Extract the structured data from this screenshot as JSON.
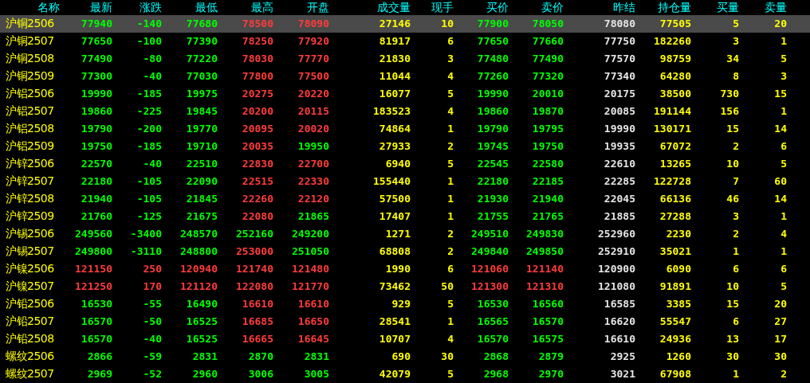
{
  "columns": [
    "名称",
    "最新",
    "涨跌",
    "最低",
    "最高",
    "开盘",
    "成交量",
    "现手",
    "买价",
    "卖价",
    "昨结",
    "持仓量",
    "买量",
    "卖量"
  ],
  "rows": [
    {
      "name": "沪铜2506",
      "selected": true,
      "cells": [
        {
          "text": "77940",
          "color": "#00ff00"
        },
        {
          "text": "-140",
          "color": "#00ff00"
        },
        {
          "text": "77680",
          "color": "#00ff00"
        },
        {
          "text": "78500",
          "color": "#ff3c3c"
        },
        {
          "text": "78090",
          "color": "#ff3c3c"
        },
        {
          "text": "27146",
          "color": "#ffff00"
        },
        {
          "text": "10",
          "color": "#ffff00"
        },
        {
          "text": "77900",
          "color": "#00ff00"
        },
        {
          "text": "78050",
          "color": "#00ff00"
        },
        {
          "text": "78080",
          "color": "#e6e6e6"
        },
        {
          "text": "77505",
          "color": "#ffff00"
        },
        {
          "text": "5",
          "color": "#ffff00"
        },
        {
          "text": "20",
          "color": "#ffff00"
        }
      ]
    },
    {
      "name": "沪铜2507",
      "selected": false,
      "cells": [
        {
          "text": "77650",
          "color": "#00ff00"
        },
        {
          "text": "-100",
          "color": "#00ff00"
        },
        {
          "text": "77390",
          "color": "#00ff00"
        },
        {
          "text": "78250",
          "color": "#ff3c3c"
        },
        {
          "text": "77920",
          "color": "#ff3c3c"
        },
        {
          "text": "81917",
          "color": "#ffff00"
        },
        {
          "text": "6",
          "color": "#ffff00"
        },
        {
          "text": "77650",
          "color": "#00ff00"
        },
        {
          "text": "77660",
          "color": "#00ff00"
        },
        {
          "text": "77750",
          "color": "#e6e6e6"
        },
        {
          "text": "182260",
          "color": "#ffff00"
        },
        {
          "text": "3",
          "color": "#ffff00"
        },
        {
          "text": "1",
          "color": "#ffff00"
        }
      ]
    },
    {
      "name": "沪铜2508",
      "selected": false,
      "cells": [
        {
          "text": "77490",
          "color": "#00ff00"
        },
        {
          "text": "-80",
          "color": "#00ff00"
        },
        {
          "text": "77220",
          "color": "#00ff00"
        },
        {
          "text": "78030",
          "color": "#ff3c3c"
        },
        {
          "text": "77770",
          "color": "#ff3c3c"
        },
        {
          "text": "21830",
          "color": "#ffff00"
        },
        {
          "text": "3",
          "color": "#ffff00"
        },
        {
          "text": "77480",
          "color": "#00ff00"
        },
        {
          "text": "77490",
          "color": "#00ff00"
        },
        {
          "text": "77570",
          "color": "#e6e6e6"
        },
        {
          "text": "98759",
          "color": "#ffff00"
        },
        {
          "text": "34",
          "color": "#ffff00"
        },
        {
          "text": "5",
          "color": "#ffff00"
        }
      ]
    },
    {
      "name": "沪铜2509",
      "selected": false,
      "cells": [
        {
          "text": "77300",
          "color": "#00ff00"
        },
        {
          "text": "-40",
          "color": "#00ff00"
        },
        {
          "text": "77030",
          "color": "#00ff00"
        },
        {
          "text": "77800",
          "color": "#ff3c3c"
        },
        {
          "text": "77500",
          "color": "#ff3c3c"
        },
        {
          "text": "11044",
          "color": "#ffff00"
        },
        {
          "text": "4",
          "color": "#ffff00"
        },
        {
          "text": "77260",
          "color": "#00ff00"
        },
        {
          "text": "77320",
          "color": "#00ff00"
        },
        {
          "text": "77340",
          "color": "#e6e6e6"
        },
        {
          "text": "64280",
          "color": "#ffff00"
        },
        {
          "text": "8",
          "color": "#ffff00"
        },
        {
          "text": "3",
          "color": "#ffff00"
        }
      ]
    },
    {
      "name": "沪铝2506",
      "selected": false,
      "cells": [
        {
          "text": "19990",
          "color": "#00ff00"
        },
        {
          "text": "-185",
          "color": "#00ff00"
        },
        {
          "text": "19975",
          "color": "#00ff00"
        },
        {
          "text": "20275",
          "color": "#ff3c3c"
        },
        {
          "text": "20220",
          "color": "#ff3c3c"
        },
        {
          "text": "16077",
          "color": "#ffff00"
        },
        {
          "text": "5",
          "color": "#ffff00"
        },
        {
          "text": "19990",
          "color": "#00ff00"
        },
        {
          "text": "20010",
          "color": "#00ff00"
        },
        {
          "text": "20175",
          "color": "#e6e6e6"
        },
        {
          "text": "38500",
          "color": "#ffff00"
        },
        {
          "text": "730",
          "color": "#ffff00"
        },
        {
          "text": "15",
          "color": "#ffff00"
        }
      ]
    },
    {
      "name": "沪铝2507",
      "selected": false,
      "cells": [
        {
          "text": "19860",
          "color": "#00ff00"
        },
        {
          "text": "-225",
          "color": "#00ff00"
        },
        {
          "text": "19845",
          "color": "#00ff00"
        },
        {
          "text": "20200",
          "color": "#ff3c3c"
        },
        {
          "text": "20115",
          "color": "#ff3c3c"
        },
        {
          "text": "183523",
          "color": "#ffff00"
        },
        {
          "text": "4",
          "color": "#ffff00"
        },
        {
          "text": "19860",
          "color": "#00ff00"
        },
        {
          "text": "19870",
          "color": "#00ff00"
        },
        {
          "text": "20085",
          "color": "#e6e6e6"
        },
        {
          "text": "191144",
          "color": "#ffff00"
        },
        {
          "text": "156",
          "color": "#ffff00"
        },
        {
          "text": "1",
          "color": "#ffff00"
        }
      ]
    },
    {
      "name": "沪铝2508",
      "selected": false,
      "cells": [
        {
          "text": "19790",
          "color": "#00ff00"
        },
        {
          "text": "-200",
          "color": "#00ff00"
        },
        {
          "text": "19770",
          "color": "#00ff00"
        },
        {
          "text": "20095",
          "color": "#ff3c3c"
        },
        {
          "text": "20020",
          "color": "#ff3c3c"
        },
        {
          "text": "74864",
          "color": "#ffff00"
        },
        {
          "text": "1",
          "color": "#ffff00"
        },
        {
          "text": "19790",
          "color": "#00ff00"
        },
        {
          "text": "19795",
          "color": "#00ff00"
        },
        {
          "text": "19990",
          "color": "#e6e6e6"
        },
        {
          "text": "130171",
          "color": "#ffff00"
        },
        {
          "text": "15",
          "color": "#ffff00"
        },
        {
          "text": "14",
          "color": "#ffff00"
        }
      ]
    },
    {
      "name": "沪铝2509",
      "selected": false,
      "cells": [
        {
          "text": "19750",
          "color": "#00ff00"
        },
        {
          "text": "-185",
          "color": "#00ff00"
        },
        {
          "text": "19710",
          "color": "#00ff00"
        },
        {
          "text": "20035",
          "color": "#ff3c3c"
        },
        {
          "text": "19950",
          "color": "#00ff00"
        },
        {
          "text": "27933",
          "color": "#ffff00"
        },
        {
          "text": "2",
          "color": "#ffff00"
        },
        {
          "text": "19745",
          "color": "#00ff00"
        },
        {
          "text": "19750",
          "color": "#00ff00"
        },
        {
          "text": "19935",
          "color": "#e6e6e6"
        },
        {
          "text": "67072",
          "color": "#ffff00"
        },
        {
          "text": "2",
          "color": "#ffff00"
        },
        {
          "text": "6",
          "color": "#ffff00"
        }
      ]
    },
    {
      "name": "沪锌2506",
      "selected": false,
      "cells": [
        {
          "text": "22570",
          "color": "#00ff00"
        },
        {
          "text": "-40",
          "color": "#00ff00"
        },
        {
          "text": "22510",
          "color": "#00ff00"
        },
        {
          "text": "22830",
          "color": "#ff3c3c"
        },
        {
          "text": "22700",
          "color": "#ff3c3c"
        },
        {
          "text": "6940",
          "color": "#ffff00"
        },
        {
          "text": "5",
          "color": "#ffff00"
        },
        {
          "text": "22545",
          "color": "#00ff00"
        },
        {
          "text": "22580",
          "color": "#00ff00"
        },
        {
          "text": "22610",
          "color": "#e6e6e6"
        },
        {
          "text": "13265",
          "color": "#ffff00"
        },
        {
          "text": "10",
          "color": "#ffff00"
        },
        {
          "text": "5",
          "color": "#ffff00"
        }
      ]
    },
    {
      "name": "沪锌2507",
      "selected": false,
      "cells": [
        {
          "text": "22180",
          "color": "#00ff00"
        },
        {
          "text": "-105",
          "color": "#00ff00"
        },
        {
          "text": "22090",
          "color": "#00ff00"
        },
        {
          "text": "22515",
          "color": "#ff3c3c"
        },
        {
          "text": "22330",
          "color": "#ff3c3c"
        },
        {
          "text": "155440",
          "color": "#ffff00"
        },
        {
          "text": "1",
          "color": "#ffff00"
        },
        {
          "text": "22180",
          "color": "#00ff00"
        },
        {
          "text": "22185",
          "color": "#00ff00"
        },
        {
          "text": "22285",
          "color": "#e6e6e6"
        },
        {
          "text": "122728",
          "color": "#ffff00"
        },
        {
          "text": "7",
          "color": "#ffff00"
        },
        {
          "text": "60",
          "color": "#ffff00"
        }
      ]
    },
    {
      "name": "沪锌2508",
      "selected": false,
      "cells": [
        {
          "text": "21940",
          "color": "#00ff00"
        },
        {
          "text": "-105",
          "color": "#00ff00"
        },
        {
          "text": "21845",
          "color": "#00ff00"
        },
        {
          "text": "22260",
          "color": "#ff3c3c"
        },
        {
          "text": "22120",
          "color": "#ff3c3c"
        },
        {
          "text": "57500",
          "color": "#ffff00"
        },
        {
          "text": "1",
          "color": "#ffff00"
        },
        {
          "text": "21930",
          "color": "#00ff00"
        },
        {
          "text": "21940",
          "color": "#00ff00"
        },
        {
          "text": "22045",
          "color": "#e6e6e6"
        },
        {
          "text": "66136",
          "color": "#ffff00"
        },
        {
          "text": "46",
          "color": "#ffff00"
        },
        {
          "text": "14",
          "color": "#ffff00"
        }
      ]
    },
    {
      "name": "沪锌2509",
      "selected": false,
      "cells": [
        {
          "text": "21760",
          "color": "#00ff00"
        },
        {
          "text": "-125",
          "color": "#00ff00"
        },
        {
          "text": "21675",
          "color": "#00ff00"
        },
        {
          "text": "22080",
          "color": "#ff3c3c"
        },
        {
          "text": "21865",
          "color": "#00ff00"
        },
        {
          "text": "17407",
          "color": "#ffff00"
        },
        {
          "text": "1",
          "color": "#ffff00"
        },
        {
          "text": "21755",
          "color": "#00ff00"
        },
        {
          "text": "21765",
          "color": "#00ff00"
        },
        {
          "text": "21885",
          "color": "#e6e6e6"
        },
        {
          "text": "27288",
          "color": "#ffff00"
        },
        {
          "text": "3",
          "color": "#ffff00"
        },
        {
          "text": "1",
          "color": "#ffff00"
        }
      ]
    },
    {
      "name": "沪锡2506",
      "selected": false,
      "cells": [
        {
          "text": "249560",
          "color": "#00ff00"
        },
        {
          "text": "-3400",
          "color": "#00ff00"
        },
        {
          "text": "248570",
          "color": "#00ff00"
        },
        {
          "text": "252160",
          "color": "#00ff00"
        },
        {
          "text": "249200",
          "color": "#00ff00"
        },
        {
          "text": "1271",
          "color": "#ffff00"
        },
        {
          "text": "2",
          "color": "#ffff00"
        },
        {
          "text": "249510",
          "color": "#00ff00"
        },
        {
          "text": "249830",
          "color": "#00ff00"
        },
        {
          "text": "252960",
          "color": "#e6e6e6"
        },
        {
          "text": "2230",
          "color": "#ffff00"
        },
        {
          "text": "2",
          "color": "#ffff00"
        },
        {
          "text": "4",
          "color": "#ffff00"
        }
      ]
    },
    {
      "name": "沪锡2507",
      "selected": false,
      "cells": [
        {
          "text": "249800",
          "color": "#00ff00"
        },
        {
          "text": "-3110",
          "color": "#00ff00"
        },
        {
          "text": "248800",
          "color": "#00ff00"
        },
        {
          "text": "253000",
          "color": "#ff3c3c"
        },
        {
          "text": "251050",
          "color": "#00ff00"
        },
        {
          "text": "68808",
          "color": "#ffff00"
        },
        {
          "text": "2",
          "color": "#ffff00"
        },
        {
          "text": "249840",
          "color": "#00ff00"
        },
        {
          "text": "249850",
          "color": "#00ff00"
        },
        {
          "text": "252910",
          "color": "#e6e6e6"
        },
        {
          "text": "35021",
          "color": "#ffff00"
        },
        {
          "text": "1",
          "color": "#ffff00"
        },
        {
          "text": "1",
          "color": "#ffff00"
        }
      ]
    },
    {
      "name": "沪镍2506",
      "selected": false,
      "cells": [
        {
          "text": "121150",
          "color": "#ff3c3c"
        },
        {
          "text": "250",
          "color": "#ff3c3c"
        },
        {
          "text": "120940",
          "color": "#ff3c3c"
        },
        {
          "text": "121740",
          "color": "#ff3c3c"
        },
        {
          "text": "121480",
          "color": "#ff3c3c"
        },
        {
          "text": "1990",
          "color": "#ffff00"
        },
        {
          "text": "6",
          "color": "#ffff00"
        },
        {
          "text": "121060",
          "color": "#ff3c3c"
        },
        {
          "text": "121140",
          "color": "#ff3c3c"
        },
        {
          "text": "120900",
          "color": "#e6e6e6"
        },
        {
          "text": "6090",
          "color": "#ffff00"
        },
        {
          "text": "6",
          "color": "#ffff00"
        },
        {
          "text": "6",
          "color": "#ffff00"
        }
      ]
    },
    {
      "name": "沪镍2507",
      "selected": false,
      "cells": [
        {
          "text": "121250",
          "color": "#ff3c3c"
        },
        {
          "text": "170",
          "color": "#ff3c3c"
        },
        {
          "text": "121120",
          "color": "#ff3c3c"
        },
        {
          "text": "122080",
          "color": "#ff3c3c"
        },
        {
          "text": "121770",
          "color": "#ff3c3c"
        },
        {
          "text": "73462",
          "color": "#ffff00"
        },
        {
          "text": "50",
          "color": "#ffff00"
        },
        {
          "text": "121300",
          "color": "#ff3c3c"
        },
        {
          "text": "121310",
          "color": "#ff3c3c"
        },
        {
          "text": "121080",
          "color": "#e6e6e6"
        },
        {
          "text": "91891",
          "color": "#ffff00"
        },
        {
          "text": "10",
          "color": "#ffff00"
        },
        {
          "text": "5",
          "color": "#ffff00"
        }
      ]
    },
    {
      "name": "沪铅2506",
      "selected": false,
      "cells": [
        {
          "text": "16530",
          "color": "#00ff00"
        },
        {
          "text": "-55",
          "color": "#00ff00"
        },
        {
          "text": "16490",
          "color": "#00ff00"
        },
        {
          "text": "16610",
          "color": "#ff3c3c"
        },
        {
          "text": "16610",
          "color": "#ff3c3c"
        },
        {
          "text": "929",
          "color": "#ffff00"
        },
        {
          "text": "5",
          "color": "#ffff00"
        },
        {
          "text": "16530",
          "color": "#00ff00"
        },
        {
          "text": "16560",
          "color": "#00ff00"
        },
        {
          "text": "16585",
          "color": "#e6e6e6"
        },
        {
          "text": "3385",
          "color": "#ffff00"
        },
        {
          "text": "15",
          "color": "#ffff00"
        },
        {
          "text": "20",
          "color": "#ffff00"
        }
      ]
    },
    {
      "name": "沪铅2507",
      "selected": false,
      "cells": [
        {
          "text": "16570",
          "color": "#00ff00"
        },
        {
          "text": "-50",
          "color": "#00ff00"
        },
        {
          "text": "16525",
          "color": "#00ff00"
        },
        {
          "text": "16685",
          "color": "#ff3c3c"
        },
        {
          "text": "16650",
          "color": "#ff3c3c"
        },
        {
          "text": "28541",
          "color": "#ffff00"
        },
        {
          "text": "1",
          "color": "#ffff00"
        },
        {
          "text": "16565",
          "color": "#00ff00"
        },
        {
          "text": "16570",
          "color": "#00ff00"
        },
        {
          "text": "16620",
          "color": "#e6e6e6"
        },
        {
          "text": "55547",
          "color": "#ffff00"
        },
        {
          "text": "6",
          "color": "#ffff00"
        },
        {
          "text": "27",
          "color": "#ffff00"
        }
      ]
    },
    {
      "name": "沪铅2508",
      "selected": false,
      "cells": [
        {
          "text": "16570",
          "color": "#00ff00"
        },
        {
          "text": "-40",
          "color": "#00ff00"
        },
        {
          "text": "16525",
          "color": "#00ff00"
        },
        {
          "text": "16665",
          "color": "#ff3c3c"
        },
        {
          "text": "16645",
          "color": "#ff3c3c"
        },
        {
          "text": "10707",
          "color": "#ffff00"
        },
        {
          "text": "4",
          "color": "#ffff00"
        },
        {
          "text": "16570",
          "color": "#00ff00"
        },
        {
          "text": "16575",
          "color": "#00ff00"
        },
        {
          "text": "16610",
          "color": "#e6e6e6"
        },
        {
          "text": "24936",
          "color": "#ffff00"
        },
        {
          "text": "13",
          "color": "#ffff00"
        },
        {
          "text": "17",
          "color": "#ffff00"
        }
      ]
    },
    {
      "name": "螺纹2506",
      "selected": false,
      "cells": [
        {
          "text": "2866",
          "color": "#00ff00"
        },
        {
          "text": "-59",
          "color": "#00ff00"
        },
        {
          "text": "2831",
          "color": "#00ff00"
        },
        {
          "text": "2870",
          "color": "#00ff00"
        },
        {
          "text": "2831",
          "color": "#00ff00"
        },
        {
          "text": "690",
          "color": "#ffff00"
        },
        {
          "text": "30",
          "color": "#ffff00"
        },
        {
          "text": "2868",
          "color": "#00ff00"
        },
        {
          "text": "2879",
          "color": "#00ff00"
        },
        {
          "text": "2925",
          "color": "#e6e6e6"
        },
        {
          "text": "1260",
          "color": "#ffff00"
        },
        {
          "text": "30",
          "color": "#ffff00"
        },
        {
          "text": "30",
          "color": "#ffff00"
        }
      ]
    },
    {
      "name": "螺纹2507",
      "selected": false,
      "cells": [
        {
          "text": "2969",
          "color": "#00ff00"
        },
        {
          "text": "-52",
          "color": "#00ff00"
        },
        {
          "text": "2960",
          "color": "#00ff00"
        },
        {
          "text": "3006",
          "color": "#00ff00"
        },
        {
          "text": "3005",
          "color": "#00ff00"
        },
        {
          "text": "42079",
          "color": "#ffff00"
        },
        {
          "text": "5",
          "color": "#ffff00"
        },
        {
          "text": "2968",
          "color": "#00ff00"
        },
        {
          "text": "2970",
          "color": "#00ff00"
        },
        {
          "text": "3021",
          "color": "#e6e6e6"
        },
        {
          "text": "67908",
          "color": "#ffff00"
        },
        {
          "text": "1",
          "color": "#ffff00"
        },
        {
          "text": "2",
          "color": "#ffff00"
        }
      ]
    }
  ]
}
